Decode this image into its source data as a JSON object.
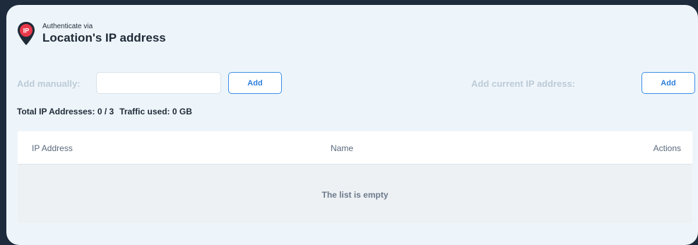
{
  "header": {
    "subtitle": "Authenticate via",
    "title": "Location's IP address",
    "icon_text": "IP",
    "icon_name": "location-pin-ip-icon",
    "icon_color": "#e8394b"
  },
  "add_manually": {
    "label": "Add manually:",
    "input_value": "",
    "input_placeholder": "",
    "button_label": "Add"
  },
  "add_current": {
    "label": "Add current IP address:",
    "button_label": "Add"
  },
  "totals": {
    "ip_addresses": "Total IP Addresses: 0 / 3",
    "traffic": "Traffic used: 0 GB"
  },
  "table": {
    "columns": [
      "IP Address",
      "Name",
      "Actions"
    ],
    "rows": [],
    "empty_text": "The list is empty"
  },
  "colors": {
    "accent": "#2d7fdc",
    "panel_bg": "#eef5fa",
    "page_bg": "#1d2b3d"
  }
}
